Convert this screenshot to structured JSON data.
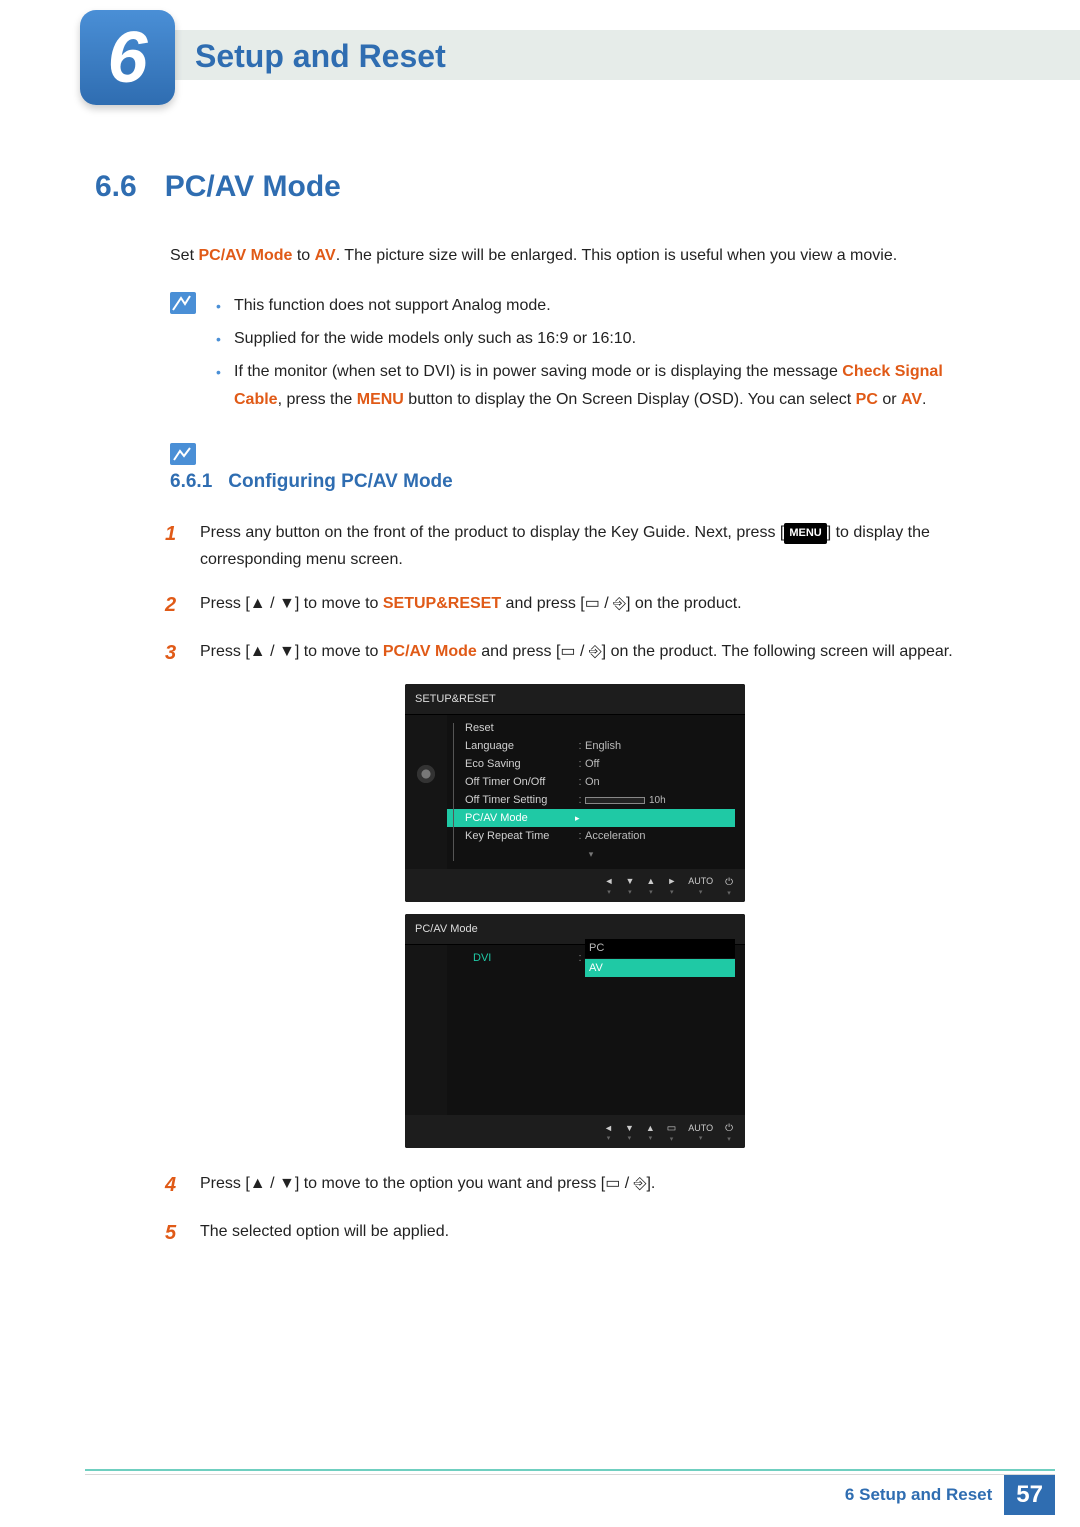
{
  "header": {
    "chapter_number": "6",
    "chapter_title": "Setup and Reset"
  },
  "section": {
    "number": "6.6",
    "title": "PC/AV Mode"
  },
  "intro": {
    "pre": "Set ",
    "bold1": "PC/AV Mode",
    "mid": " to ",
    "bold2": "AV",
    "post": ". The picture size will be enlarged. This option is useful when you view a movie."
  },
  "notes": {
    "item1": "This function does not support Analog mode.",
    "item2": "Supplied for the wide models only such as 16:9 or 16:10.",
    "item3_pre": "If the monitor (when set to DVI) is in power saving mode or is displaying the message ",
    "item3_o1": "Check Signal Cable",
    "item3_mid1": ", press the ",
    "item3_o2": "MENU",
    "item3_mid2": " button to display the On Screen Display (OSD). You can select ",
    "item3_o3": "PC",
    "item3_mid3": " or ",
    "item3_o4": "AV",
    "item3_post": "."
  },
  "subsection": {
    "number": "6.6.1",
    "title": "Configuring PC/AV Mode"
  },
  "steps": {
    "s1_pre": "Press any button on the front of the product to display the Key Guide. Next, press [",
    "s1_menu": "MENU",
    "s1_post": "] to display the corresponding menu screen.",
    "s2_pre": "Press [",
    "s2_sym1": "▲ / ▼",
    "s2_mid1": "] to move to ",
    "s2_orange": "SETUP&RESET",
    "s2_mid2": " and press [",
    "s2_sym2": "▭ / ⎆",
    "s2_post": "] on the product.",
    "s3_pre": "Press [",
    "s3_sym1": "▲ / ▼",
    "s3_mid1": "] to move to ",
    "s3_orange": "PC/AV Mode",
    "s3_mid2": " and press [",
    "s3_sym2": "▭ / ⎆",
    "s3_post": "] on the product. The following screen will appear.",
    "s4_pre": "Press [",
    "s4_sym1": "▲ / ▼",
    "s4_mid1": "] to move to the option you want and press [",
    "s4_sym2": "▭ / ⎆",
    "s4_post": "].",
    "s5": "The selected option will be applied."
  },
  "step_nums": {
    "n1": "1",
    "n2": "2",
    "n3": "3",
    "n4": "4",
    "n5": "5"
  },
  "osd1": {
    "title": "SETUP&RESET",
    "rows": {
      "reset": "Reset",
      "language": "Language",
      "language_v": "English",
      "eco": "Eco Saving",
      "eco_v": "Off",
      "offtimer": "Off Timer On/Off",
      "offtimer_v": "On",
      "offtimerset": "Off Timer Setting",
      "offtimerset_v": "10h",
      "pcav": "PC/AV Mode",
      "keyrepeat": "Key Repeat Time",
      "keyrepeat_v": "Acceleration"
    },
    "footer": {
      "auto": "AUTO"
    }
  },
  "osd2": {
    "title": "PC/AV Mode",
    "dvi": "DVI",
    "pc": "PC",
    "av": "AV",
    "footer": {
      "auto": "AUTO"
    }
  },
  "footer": {
    "text": "6 Setup and Reset",
    "page": "57"
  }
}
